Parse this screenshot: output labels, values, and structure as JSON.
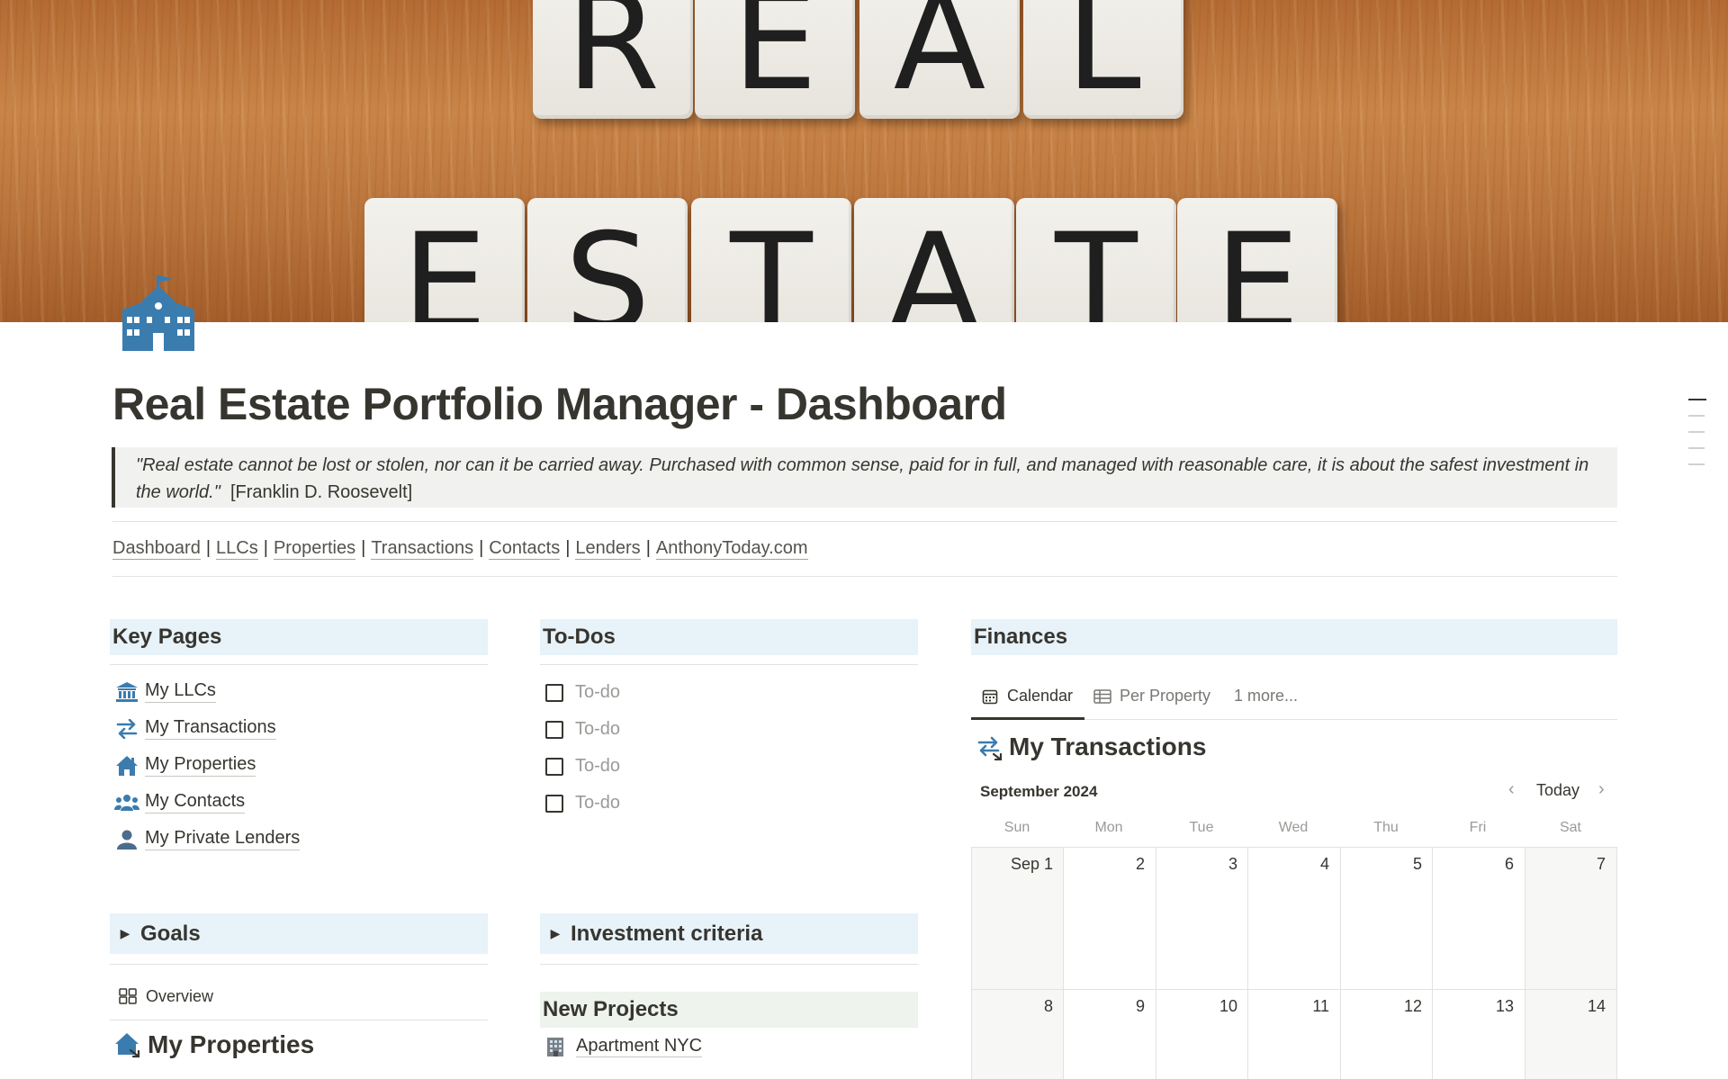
{
  "cover": {
    "row1_letters": [
      "R",
      "E",
      "A",
      "L"
    ],
    "row2_letters": [
      "E",
      "S",
      "T",
      "A",
      "T",
      "E"
    ]
  },
  "page_icon": "school-building-icon",
  "title": "Real Estate Portfolio Manager - Dashboard",
  "quote": {
    "text": "\"Real estate cannot be lost or stolen, nor can it be carried away. Purchased with common sense, paid for in full, and managed with reasonable care, it is about the safest investment in the world.\"",
    "author": "[Franklin D. Roosevelt]"
  },
  "nav": {
    "links": [
      "Dashboard",
      "LLCs",
      "Properties",
      "Transactions",
      "Contacts",
      "Lenders",
      "AnthonyToday.com"
    ],
    "separator": "|"
  },
  "key_pages": {
    "heading": "Key Pages",
    "items": [
      {
        "label": "My LLCs",
        "icon": "bank-icon"
      },
      {
        "label": "My Transactions",
        "icon": "arrows-swap-icon"
      },
      {
        "label": "My Properties",
        "icon": "house-icon"
      },
      {
        "label": "My Contacts",
        "icon": "people-icon"
      },
      {
        "label": "My Private Lenders",
        "icon": "person-icon"
      }
    ]
  },
  "todos": {
    "heading": "To-Dos",
    "items": [
      "To-do",
      "To-do",
      "To-do",
      "To-do"
    ]
  },
  "finances": {
    "heading": "Finances",
    "tabs": [
      {
        "label": "Calendar",
        "icon": "calendar-icon",
        "active": true
      },
      {
        "label": "Per Property",
        "icon": "table-icon",
        "active": false
      },
      {
        "label": "1 more...",
        "icon": "",
        "active": false
      }
    ],
    "db_title": "My Transactions",
    "month": "September 2024",
    "today_label": "Today",
    "weekdays": [
      "Sun",
      "Mon",
      "Tue",
      "Wed",
      "Thu",
      "Fri",
      "Sat"
    ],
    "week1": [
      "Sep 1",
      "2",
      "3",
      "4",
      "5",
      "6",
      "7"
    ],
    "week2": [
      "8",
      "9",
      "10",
      "11",
      "12",
      "13",
      "14"
    ]
  },
  "goals": {
    "heading": "Goals",
    "view_label": "Overview",
    "db_title": "My Properties"
  },
  "investment": {
    "heading": "Investment criteria"
  },
  "new_projects": {
    "heading": "New Projects",
    "items": [
      {
        "label": "Apartment NYC",
        "icon": "office-building-icon"
      }
    ]
  }
}
